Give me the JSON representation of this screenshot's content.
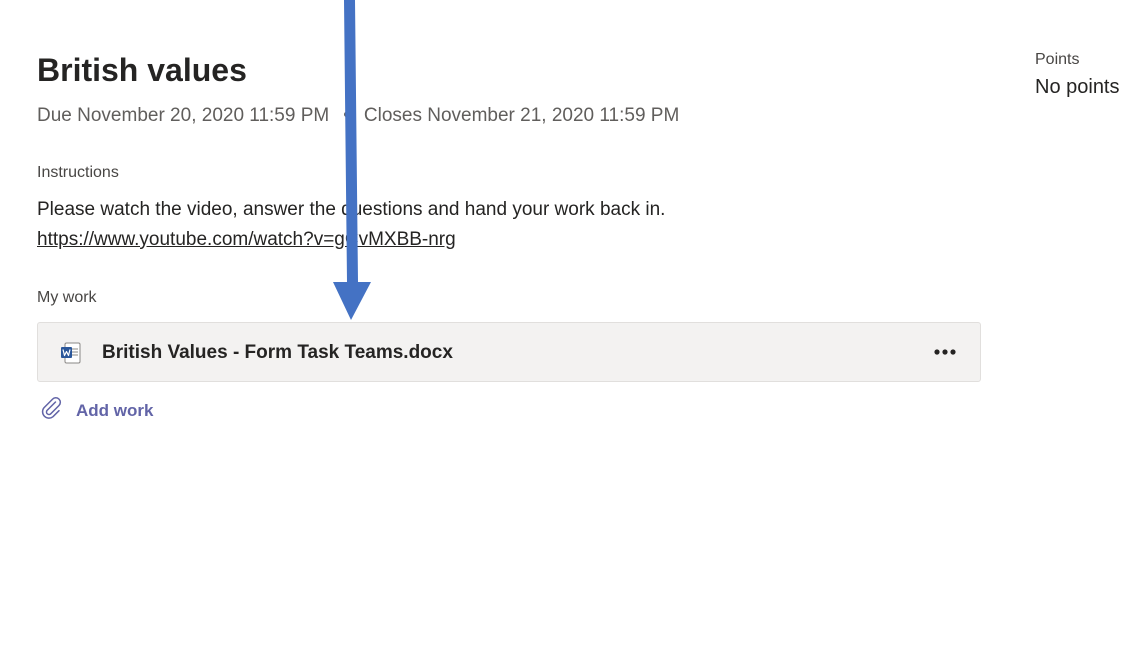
{
  "assignment": {
    "title": "British values",
    "due": "Due November 20, 2020 11:59 PM",
    "separator": "•",
    "closes": "Closes November 21, 2020 11:59 PM"
  },
  "instructions": {
    "label": "Instructions",
    "text": "Please watch the video, answer the questions and hand your work back in. ",
    "link": "https://www.youtube.com/watch?v=gCvMXBB-nrg"
  },
  "my_work": {
    "label": "My work",
    "file": {
      "name": "British Values - Form Task Teams.docx",
      "icon": "word-document-icon",
      "more_label": "•••"
    },
    "add_work_label": "Add work",
    "add_work_icon": "paperclip-icon"
  },
  "points": {
    "label": "Points",
    "value": "No points"
  },
  "colors": {
    "accent": "#6264a7",
    "annotation_arrow": "#4472c4",
    "card_background": "#f3f2f1"
  }
}
